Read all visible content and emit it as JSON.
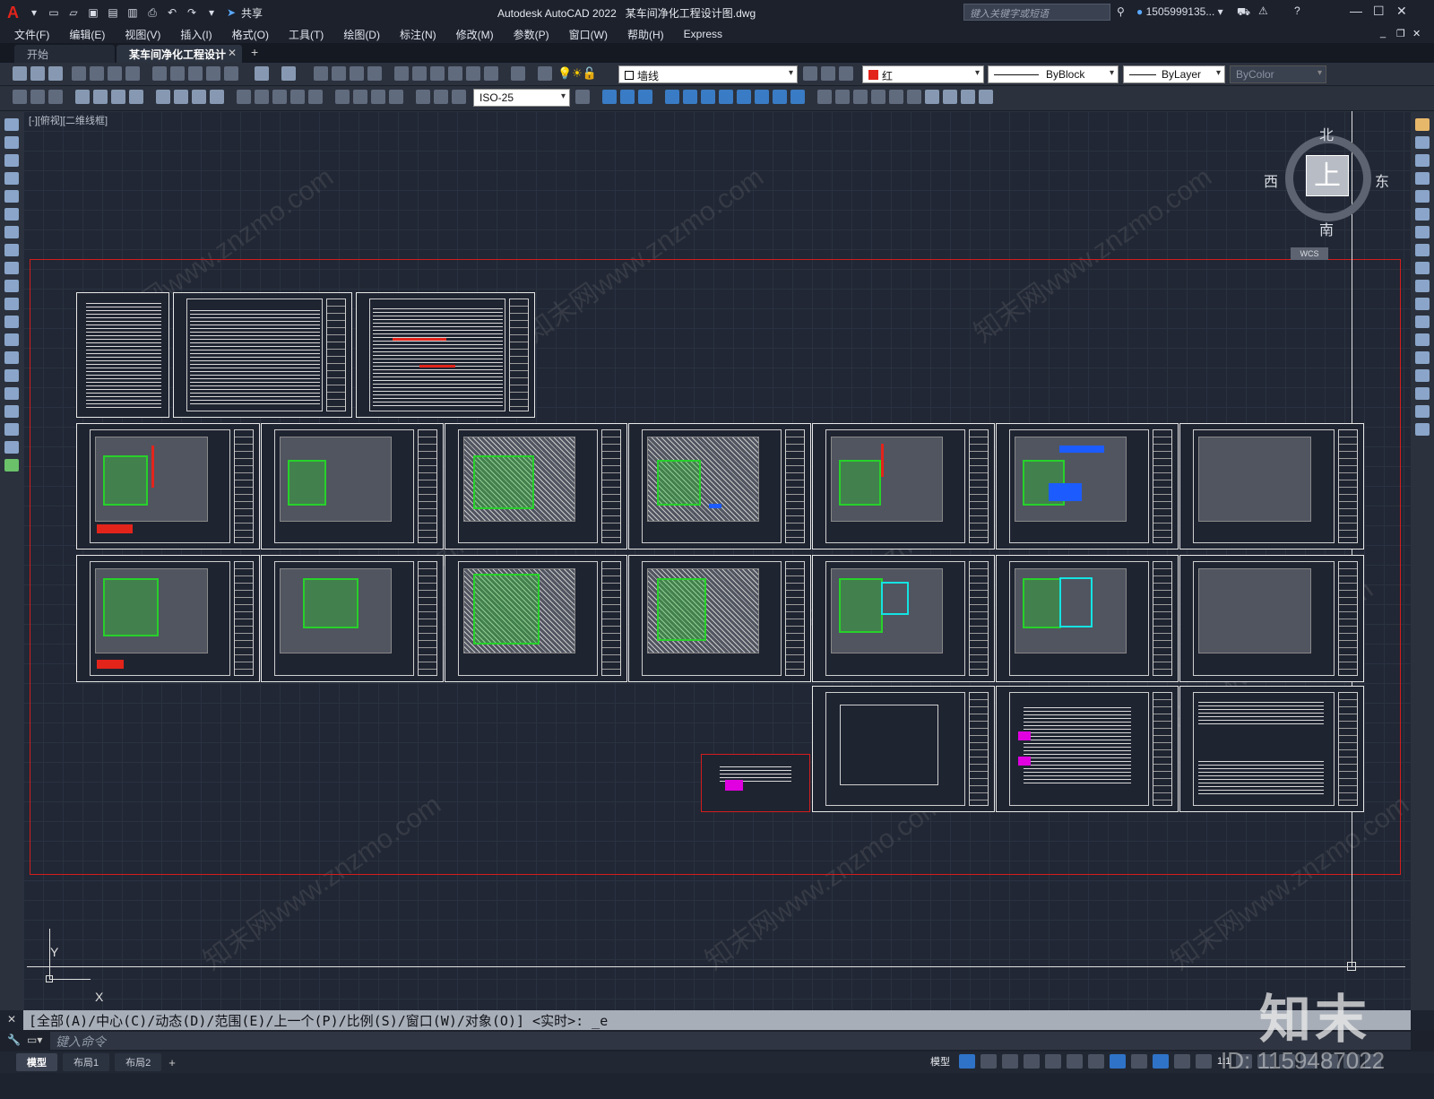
{
  "title_bar": {
    "app_name": "Autodesk AutoCAD 2022",
    "file_name": "某车间净化工程设计图.dwg",
    "share_label": "共享",
    "search_placeholder": "键入关键字或短语",
    "user": "1505999135..."
  },
  "menu": [
    "文件(F)",
    "编辑(E)",
    "视图(V)",
    "插入(I)",
    "格式(O)",
    "工具(T)",
    "绘图(D)",
    "标注(N)",
    "修改(M)",
    "参数(P)",
    "窗口(W)",
    "帮助(H)",
    "Express"
  ],
  "doc_tabs": {
    "start": "开始",
    "active": "某车间净化工程设计图*",
    "close": "✕",
    "add": "+"
  },
  "toolbar": {
    "layer_value": "墙线",
    "color_value": "红",
    "linetype_value": "ByBlock",
    "lineweight_value": "ByLayer",
    "plotstyle_value": "ByColor",
    "dimstyle_value": "ISO-25"
  },
  "viewport_label": "[-][俯视][二维线框]",
  "viewcube": {
    "north": "北",
    "south": "南",
    "east": "东",
    "west": "西",
    "top": "上",
    "wcs": "WCS"
  },
  "ucs": {
    "x": "X",
    "y": "Y"
  },
  "command": {
    "history": "[全部(A)/中心(C)/动态(D)/范围(E)/上一个(P)/比例(S)/窗口(W)/对象(O)] <实时>: _e",
    "placeholder": "键入命令"
  },
  "layout_tabs": [
    "模型",
    "布局1",
    "布局2",
    "+"
  ],
  "status": {
    "model": "模型",
    "scale": "1:1"
  },
  "watermark": {
    "logo": "知末",
    "id": "ID: 1159487022",
    "site": "知末网www.znzmo.com"
  },
  "colors": {
    "accent_red": "#e3241b",
    "green": "#27d12a",
    "blue": "#1c5cff",
    "cyan": "#14e3e3",
    "canvas": "#212734"
  }
}
